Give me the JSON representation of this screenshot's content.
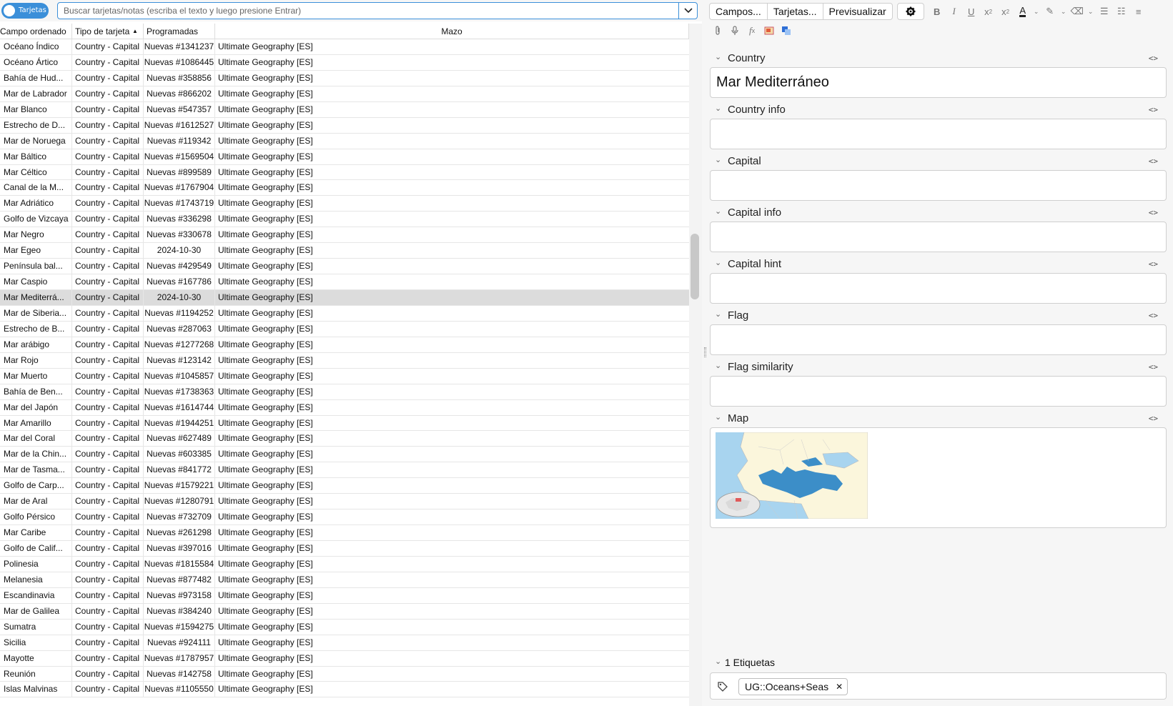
{
  "search": {
    "toggle_label": "Tarjetas",
    "placeholder": "Buscar tarjetas/notas (escriba el texto y luego presione Entrar)"
  },
  "table": {
    "columns": [
      "Campo ordenado",
      "Tipo de tarjeta",
      "Programadas",
      "Mazo"
    ],
    "rows": [
      [
        "Océano Índico",
        "Country - Capital",
        "Nuevas #1341237",
        "Ultimate Geography [ES]"
      ],
      [
        "Océano Ártico",
        "Country - Capital",
        "Nuevas #1086445",
        "Ultimate Geography [ES]"
      ],
      [
        "Bahía de Hud...",
        "Country - Capital",
        "Nuevas #358856",
        "Ultimate Geography [ES]"
      ],
      [
        "Mar de Labrador",
        "Country - Capital",
        "Nuevas #866202",
        "Ultimate Geography [ES]"
      ],
      [
        "Mar Blanco",
        "Country - Capital",
        "Nuevas #547357",
        "Ultimate Geography [ES]"
      ],
      [
        "Estrecho de D...",
        "Country - Capital",
        "Nuevas #1612527",
        "Ultimate Geography [ES]"
      ],
      [
        "Mar de Noruega",
        "Country - Capital",
        "Nuevas #119342",
        "Ultimate Geography [ES]"
      ],
      [
        "Mar Báltico",
        "Country - Capital",
        "Nuevas #1569504",
        "Ultimate Geography [ES]"
      ],
      [
        "Mar Céltico",
        "Country - Capital",
        "Nuevas #899589",
        "Ultimate Geography [ES]"
      ],
      [
        "Canal de la M...",
        "Country - Capital",
        "Nuevas #1767904",
        "Ultimate Geography [ES]"
      ],
      [
        "Mar Adriático",
        "Country - Capital",
        "Nuevas #1743719",
        "Ultimate Geography [ES]"
      ],
      [
        "Golfo de Vizcaya",
        "Country - Capital",
        "Nuevas #336298",
        "Ultimate Geography [ES]"
      ],
      [
        "Mar Negro",
        "Country - Capital",
        "Nuevas #330678",
        "Ultimate Geography [ES]"
      ],
      [
        "Mar Egeo",
        "Country - Capital",
        "2024-10-30",
        "Ultimate Geography [ES]"
      ],
      [
        "Península bal...",
        "Country - Capital",
        "Nuevas #429549",
        "Ultimate Geography [ES]"
      ],
      [
        "Mar Caspio",
        "Country - Capital",
        "Nuevas #167786",
        "Ultimate Geography [ES]"
      ],
      [
        "Mar Mediterrá...",
        "Country - Capital",
        "2024-10-30",
        "Ultimate Geography [ES]"
      ],
      [
        "Mar de Siberia...",
        "Country - Capital",
        "Nuevas #1194252",
        "Ultimate Geography [ES]"
      ],
      [
        "Estrecho de B...",
        "Country - Capital",
        "Nuevas #287063",
        "Ultimate Geography [ES]"
      ],
      [
        "Mar arábigo",
        "Country - Capital",
        "Nuevas #1277268",
        "Ultimate Geography [ES]"
      ],
      [
        "Mar Rojo",
        "Country - Capital",
        "Nuevas #123142",
        "Ultimate Geography [ES]"
      ],
      [
        "Mar Muerto",
        "Country - Capital",
        "Nuevas #1045857",
        "Ultimate Geography [ES]"
      ],
      [
        "Bahía de Ben...",
        "Country - Capital",
        "Nuevas #1738363",
        "Ultimate Geography [ES]"
      ],
      [
        "Mar del Japón",
        "Country - Capital",
        "Nuevas #1614744",
        "Ultimate Geography [ES]"
      ],
      [
        "Mar Amarillo",
        "Country - Capital",
        "Nuevas #1944251",
        "Ultimate Geography [ES]"
      ],
      [
        "Mar del Coral",
        "Country - Capital",
        "Nuevas #627489",
        "Ultimate Geography [ES]"
      ],
      [
        "Mar de la Chin...",
        "Country - Capital",
        "Nuevas #603385",
        "Ultimate Geography [ES]"
      ],
      [
        "Mar de Tasma...",
        "Country - Capital",
        "Nuevas #841772",
        "Ultimate Geography [ES]"
      ],
      [
        "Golfo de Carp...",
        "Country - Capital",
        "Nuevas #1579221",
        "Ultimate Geography [ES]"
      ],
      [
        "Mar de Aral",
        "Country - Capital",
        "Nuevas #1280791",
        "Ultimate Geography [ES]"
      ],
      [
        "Golfo Pérsico",
        "Country - Capital",
        "Nuevas #732709",
        "Ultimate Geography [ES]"
      ],
      [
        "Mar Caribe",
        "Country - Capital",
        "Nuevas #261298",
        "Ultimate Geography [ES]"
      ],
      [
        "Golfo de Calif...",
        "Country - Capital",
        "Nuevas #397016",
        "Ultimate Geography [ES]"
      ],
      [
        "Polinesia",
        "Country - Capital",
        "Nuevas #1815584",
        "Ultimate Geography [ES]"
      ],
      [
        "Melanesia",
        "Country - Capital",
        "Nuevas #877482",
        "Ultimate Geography [ES]"
      ],
      [
        "Escandinavia",
        "Country - Capital",
        "Nuevas #973158",
        "Ultimate Geography [ES]"
      ],
      [
        "Mar de Galilea",
        "Country - Capital",
        "Nuevas #384240",
        "Ultimate Geography [ES]"
      ],
      [
        "Sumatra",
        "Country - Capital",
        "Nuevas #1594275",
        "Ultimate Geography [ES]"
      ],
      [
        "Sicilia",
        "Country - Capital",
        "Nuevas #924111",
        "Ultimate Geography [ES]"
      ],
      [
        "Mayotte",
        "Country - Capital",
        "Nuevas #1787957",
        "Ultimate Geography [ES]"
      ],
      [
        "Reunión",
        "Country - Capital",
        "Nuevas #142758",
        "Ultimate Geography [ES]"
      ],
      [
        "Islas Malvinas",
        "Country - Capital",
        "Nuevas #1105550",
        "Ultimate Geography [ES]"
      ]
    ],
    "selected_row": 16,
    "sort_column": "Tipo de tarjeta",
    "sort_direction": "ascending"
  },
  "editor": {
    "toolbar": {
      "fields_label": "Campos...",
      "cards_label": "Tarjetas...",
      "preview_label": "Previsualizar",
      "icons": [
        "gear-icon",
        "bold-icon",
        "italic-icon",
        "underline-icon",
        "superscript-icon",
        "subscript-icon",
        "text-color-icon",
        "highlight-icon",
        "eraser-icon",
        "bullet-list-icon",
        "numbered-list-icon",
        "align-icon",
        "attach-icon",
        "microphone-icon",
        "formula-icon",
        "image-occlusion-icon",
        "translate-icon"
      ]
    },
    "fields": [
      {
        "name": "Country",
        "value": "Mar Mediterráneo"
      },
      {
        "name": "Country info",
        "value": ""
      },
      {
        "name": "Capital",
        "value": ""
      },
      {
        "name": "Capital info",
        "value": ""
      },
      {
        "name": "Capital hint",
        "value": ""
      },
      {
        "name": "Flag",
        "value": ""
      },
      {
        "name": "Flag similarity",
        "value": ""
      },
      {
        "name": "Map",
        "value": ""
      }
    ],
    "tags": {
      "header": "1 Etiquetas",
      "items": [
        "UG::Oceans+Seas"
      ]
    }
  },
  "colors": {
    "accent": "#3b8fd9",
    "selected_row": "#dcdcdc",
    "map_water": "#a8d4ef",
    "map_land": "#fbf6dc",
    "map_highlight": "#3c8ec8"
  }
}
